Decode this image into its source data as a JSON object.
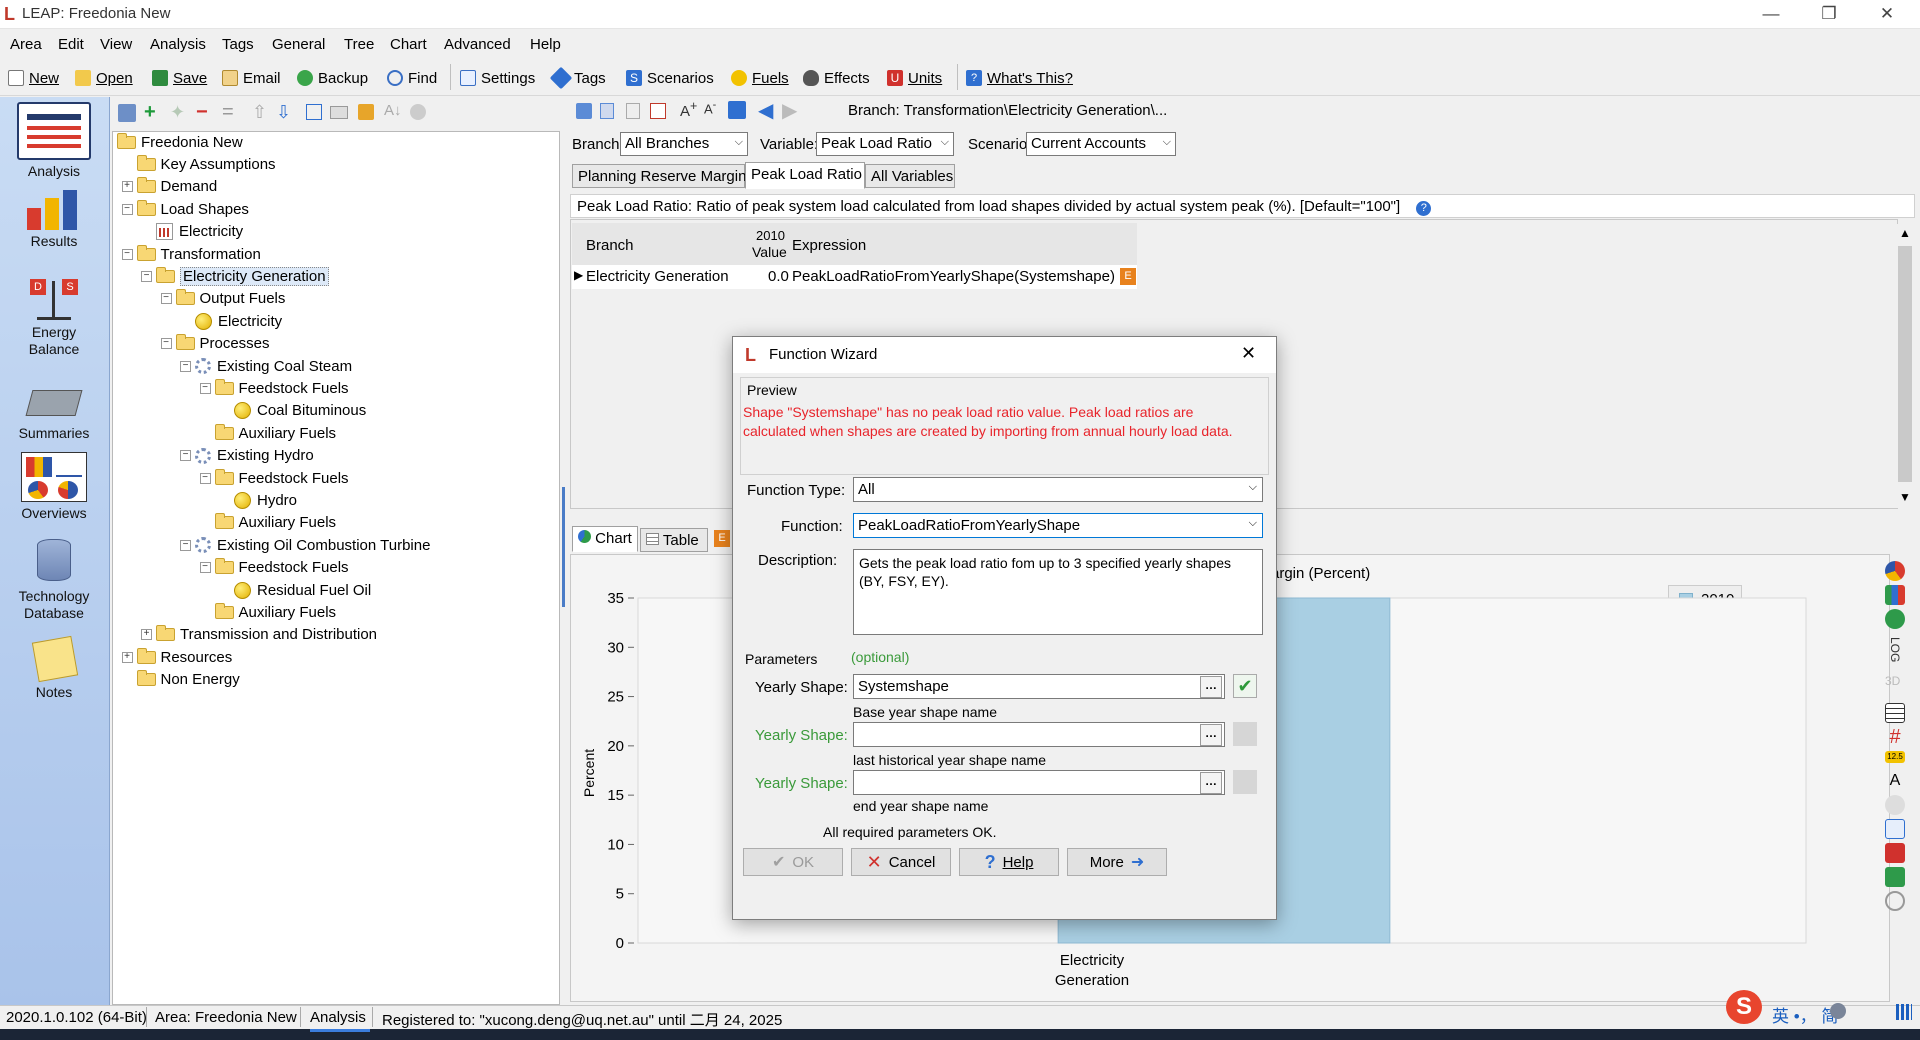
{
  "window": {
    "title": "LEAP: Freedonia New",
    "minimize": "—",
    "restore": "❐",
    "close": "✕"
  },
  "menubar": [
    "Area",
    "Edit",
    "View",
    "Analysis",
    "Tags",
    "General",
    "Tree",
    "Chart",
    "Advanced",
    "Help"
  ],
  "toolbar": {
    "new": "New",
    "open": "Open",
    "save": "Save",
    "email": "Email",
    "backup": "Backup",
    "find": "Find",
    "settings": "Settings",
    "tags": "Tags",
    "scenarios": "Scenarios",
    "fuels": "Fuels",
    "effects": "Effects",
    "units": "Units",
    "whats_this": "What's This?"
  },
  "leftnav": [
    "Analysis",
    "Results",
    "Energy Balance",
    "Summaries",
    "Overviews",
    "Technology Database",
    "Notes"
  ],
  "tree": [
    {
      "label": "Freedonia New",
      "indent": 0,
      "type": "folder"
    },
    {
      "label": "Key Assumptions",
      "indent": 1,
      "type": "folder"
    },
    {
      "label": "Demand",
      "indent": 1,
      "type": "folder",
      "exp": "+"
    },
    {
      "label": "Load Shapes",
      "indent": 1,
      "type": "folder",
      "exp": "−"
    },
    {
      "label": "Electricity",
      "indent": 2,
      "type": "load"
    },
    {
      "label": "Transformation",
      "indent": 1,
      "type": "folder",
      "exp": "−"
    },
    {
      "label": "Electricity Generation",
      "indent": 2,
      "type": "folder",
      "exp": "−",
      "selected": true
    },
    {
      "label": "Output Fuels",
      "indent": 3,
      "type": "folder",
      "exp": "−"
    },
    {
      "label": "Electricity",
      "indent": 4,
      "type": "fuel"
    },
    {
      "label": "Processes",
      "indent": 3,
      "type": "folder",
      "exp": "−"
    },
    {
      "label": "Existing Coal Steam",
      "indent": 4,
      "type": "gear",
      "exp": "−"
    },
    {
      "label": "Feedstock Fuels",
      "indent": 5,
      "type": "folder",
      "exp": "−"
    },
    {
      "label": "Coal Bituminous",
      "indent": 6,
      "type": "fuel"
    },
    {
      "label": "Auxiliary Fuels",
      "indent": 5,
      "type": "folder"
    },
    {
      "label": "Existing Hydro",
      "indent": 4,
      "type": "gear",
      "exp": "−"
    },
    {
      "label": "Feedstock Fuels",
      "indent": 5,
      "type": "folder",
      "exp": "−"
    },
    {
      "label": "Hydro",
      "indent": 6,
      "type": "fuel"
    },
    {
      "label": "Auxiliary Fuels",
      "indent": 5,
      "type": "folder"
    },
    {
      "label": "Existing Oil Combustion Turbine",
      "indent": 4,
      "type": "gear",
      "exp": "−"
    },
    {
      "label": "Feedstock Fuels",
      "indent": 5,
      "type": "folder",
      "exp": "−"
    },
    {
      "label": "Residual Fuel Oil",
      "indent": 6,
      "type": "fuel"
    },
    {
      "label": "Auxiliary Fuels",
      "indent": 5,
      "type": "folder"
    },
    {
      "label": "Transmission and Distribution",
      "indent": 2,
      "type": "folder",
      "exp": "+"
    },
    {
      "label": "Resources",
      "indent": 1,
      "type": "folder",
      "exp": "+"
    },
    {
      "label": "Non Energy",
      "indent": 1,
      "type": "folder"
    }
  ],
  "right": {
    "branch_path": "Branch: Transformation\\Electricity Generation\\...",
    "branch_label": "Branch:",
    "branch_value": "All Branches",
    "variable_label": "Variable:",
    "variable_value": "Peak Load Ratio",
    "scenario_label": "Scenario:",
    "scenario_value": "Current Accounts",
    "tabs": [
      "Planning Reserve Margin",
      "Peak Load Ratio",
      "All Variables"
    ],
    "description": "Peak Load Ratio: Ratio of peak system load calculated from load shapes divided by actual system peak (%). [Default=\"100\"]",
    "grid": {
      "col_branch": "Branch",
      "col_year": "2010",
      "col_value": "Value",
      "col_expr": "Expression",
      "row_branch": "Electricity Generation",
      "row_value": "0.0",
      "row_expr": "PeakLoadRatioFromYearlyShape(Systemshape)",
      "row_badge": "E"
    }
  },
  "chart_tabs": {
    "chart": "Chart",
    "table": "Table",
    "badge": "E"
  },
  "chart_data": {
    "type": "bar",
    "title_fragment": "argin (Percent)",
    "ylabel": "Percent",
    "ylim": [
      0,
      35
    ],
    "yticks": [
      0,
      5,
      10,
      15,
      20,
      25,
      30,
      35
    ],
    "categories": [
      "Electricity Generation"
    ],
    "category_lines": [
      "Electricity",
      "Generation"
    ],
    "series": [
      {
        "name": "2010",
        "values": [
          35
        ],
        "color": "#a9cfe3"
      }
    ],
    "legend": "top-right"
  },
  "right_icons_text": {
    "log": "LOG",
    "three_d": "3D",
    "num": "12.5"
  },
  "status": {
    "version": "2020.1.0.102 (64-Bit)",
    "area": "Area: Freedonia New",
    "view": "Analysis",
    "registered": "Registered to: \"xucong.deng@uq.net.au\" until 二月 24, 2025",
    "ime": "英 •， 简"
  },
  "dialog": {
    "title": "Function Wizard",
    "close": "✕",
    "preview_label": "Preview",
    "preview_message": "Shape \"Systemshape\" has no peak load ratio value. Peak load ratios are calculated when shapes are created by importing from annual hourly load data.",
    "function_type_label": "Function Type:",
    "function_type_value": "All",
    "function_label": "Function:",
    "function_value": "PeakLoadRatioFromYearlyShape",
    "description_label": "Description:",
    "description_value": "Gets the peak load ratio fom up to 3 specified yearly shapes (BY, FSY, EY).",
    "parameters_label": "Parameters",
    "optional_label": "(optional)",
    "params": [
      {
        "label": "Yearly Shape:",
        "value": "Systemshape",
        "hint": "Base year shape name"
      },
      {
        "label": "Yearly Shape:",
        "value": "",
        "hint": "last historical year shape name"
      },
      {
        "label": "Yearly Shape:",
        "value": "",
        "hint": "end year shape name"
      }
    ],
    "ellipsis": "…",
    "status_text": "All required parameters OK.",
    "ok": "OK",
    "cancel": "Cancel",
    "help": "Help",
    "more": "More"
  },
  "colors": {
    "accent": "#0078d7",
    "error_text": "#e8242b",
    "optional_green": "#3a9a3a",
    "bar": "#a9cfe3",
    "nav_bg": "#b8cff0"
  }
}
